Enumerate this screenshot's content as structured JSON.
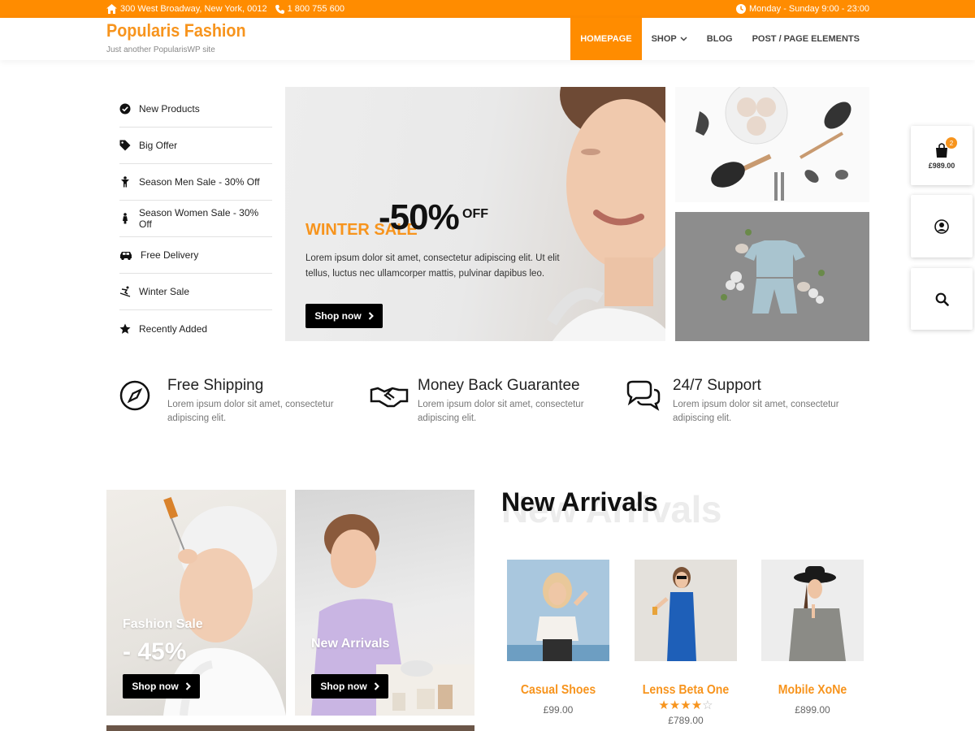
{
  "topbar": {
    "address": "300 West Broadway, New York, 0012",
    "phone": "1 800 755 600",
    "hours": "Monday - Sunday 9:00 - 23:00"
  },
  "header": {
    "logo": "Popularis Fashion",
    "tagline": "Just another PopularisWP site",
    "nav": [
      {
        "label": "HOMEPAGE"
      },
      {
        "label": "SHOP"
      },
      {
        "label": "BLOG"
      },
      {
        "label": "POST / PAGE ELEMENTS"
      }
    ]
  },
  "sidebar": {
    "items": [
      {
        "label": "New Products",
        "icon": "check-circle-icon"
      },
      {
        "label": "Big Offer",
        "icon": "tag-icon"
      },
      {
        "label": "Season Men Sale - 30% Off",
        "icon": "male-icon"
      },
      {
        "label": "Season Women Sale - 30% Off",
        "icon": "female-icon"
      },
      {
        "label": "Free Delivery",
        "icon": "car-icon"
      },
      {
        "label": "Winter Sale",
        "icon": "skiing-icon"
      },
      {
        "label": "Recently Added",
        "icon": "star-icon"
      }
    ]
  },
  "hero": {
    "sale_label": "WINTER SALE",
    "percent": "-50%",
    "off": "OFF",
    "description": "Lorem ipsum dolor sit amet, consectetur adipiscing elit. Ut elit tellus, luctus nec ullamcorper mattis, pulvinar dapibus leo.",
    "button": "Shop now"
  },
  "floating": {
    "cart_count": "2",
    "cart_total": "£989.00"
  },
  "features": [
    {
      "title": "Free Shipping",
      "desc": "Lorem ipsum dolor sit amet, consectetur adipiscing elit."
    },
    {
      "title": "Money Back Guarantee",
      "desc": "Lorem ipsum dolor sit amet, consectetur adipiscing elit."
    },
    {
      "title": "24/7 Support",
      "desc": "Lorem ipsum dolor sit amet, consectetur adipiscing elit."
    }
  ],
  "cards": [
    {
      "title": "Fashion Sale",
      "percent": "- 45%",
      "button": "Shop now"
    },
    {
      "title": "New Arrivals",
      "button": "Shop now"
    }
  ],
  "new_arrivals": {
    "title": "New Arrivals",
    "watermark": "New Arrivals",
    "products": [
      {
        "name": "Casual Shoes",
        "price": "£99.00"
      },
      {
        "name": "Lenss Beta One",
        "price": "£789.00",
        "rating": 4,
        "rating_max": 5
      },
      {
        "name": "Mobile XoNe",
        "price": "£899.00"
      }
    ]
  },
  "colors": {
    "accent": "#ff8c00",
    "brand_text": "#f7941d",
    "button": "#000000"
  }
}
